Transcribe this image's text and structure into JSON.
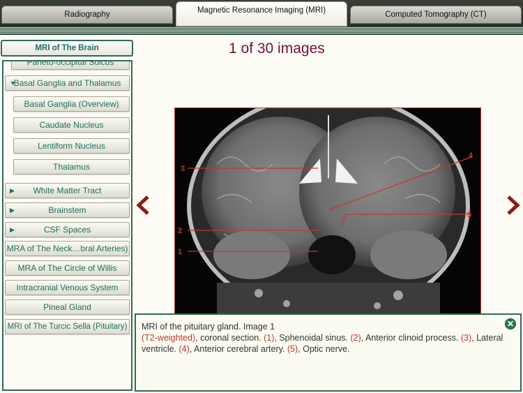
{
  "tabs": [
    {
      "label": "Radiography"
    },
    {
      "label": "Magnetic Resonance Imaging (MRI)"
    },
    {
      "label": "Computed Tomography (CT)"
    }
  ],
  "sidebar": {
    "header": "MRI of The Brain",
    "items": [
      {
        "label": "Parieto-occipital Sulcus"
      },
      {
        "label": "Basal Ganglia and Thalamus"
      },
      {
        "label": "Basal Ganglia (Overview)"
      },
      {
        "label": "Caudate Nucleus"
      },
      {
        "label": "Lentiform Nucleus"
      },
      {
        "label": "Thalamus"
      },
      {
        "label": "White Matter Tract"
      },
      {
        "label": "Brainstem"
      },
      {
        "label": "CSF Spaces"
      },
      {
        "label": "MRA of The Neck…bral Arteries)"
      },
      {
        "label": "MRA of The Circle of Willis"
      },
      {
        "label": "Intracranial Venous System"
      },
      {
        "label": "Pineal Gland"
      },
      {
        "label": "MRI of The Turcic Sella (Pituitary)"
      }
    ]
  },
  "viewer": {
    "counter": "1 of 30 images",
    "markers": [
      "1",
      "2",
      "3",
      "4",
      "5"
    ],
    "prev_glyph": "‹",
    "next_glyph": "›"
  },
  "caption": {
    "line1": "MRI of the pituitary gland. Image 1",
    "weighting": "(T2-weighted)",
    "t1": ", coronal section. ",
    "n1": "(1)",
    "t2": ", Sphenoidal sinus. ",
    "n2": "(2)",
    "t3": ", Anterior clinoid process. ",
    "n3": "(3)",
    "t4": ", Lateral ventricle.  ",
    "n4": "(4)",
    "t5": ", Anterior cerebral artery.  ",
    "n5": "(5)",
    "t6": ", Optic nerve.",
    "close_glyph": "✕"
  },
  "colors": {
    "accent": "#2e6a5a",
    "marker": "#c0392b",
    "counter": "#6c1338"
  }
}
